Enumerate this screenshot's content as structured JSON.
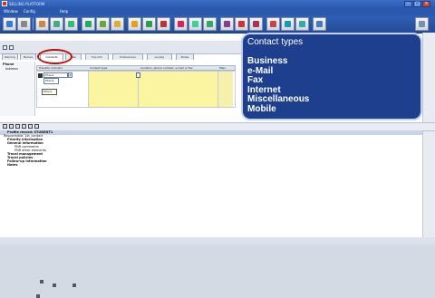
{
  "window": {
    "title": "SELLING PLATFORM"
  },
  "menu": [
    {
      "label": "Window"
    },
    {
      "label": "Config"
    },
    {
      "label": "Help"
    }
  ],
  "toolbar_icons": [
    "user-icon",
    "print-icon",
    "cut-icon",
    "network-icon",
    "globe-icon",
    "printer-icon",
    "tools-icon",
    "book-icon",
    "folder-icon",
    "arrow-icon",
    "plane-icon",
    "calendar-icon",
    "mail-icon",
    "chart-icon",
    "phone-icon",
    "car-icon",
    "hotel-icon",
    "ticket-icon",
    "search-icon",
    "settings-icon",
    "exit-icon"
  ],
  "tabs": [
    {
      "label": "Naming",
      "active": false
    },
    {
      "label": "Names",
      "active": false
    },
    {
      "label": "Contacts",
      "active": true
    },
    {
      "label": "Mail",
      "active": false
    },
    {
      "label": "Fop Info",
      "active": false
    },
    {
      "label": "Preferences",
      "active": false
    },
    {
      "label": "Loyalty",
      "active": false
    },
    {
      "label": "Notes",
      "active": false
    }
  ],
  "left_panel": {
    "heading": "Phone",
    "item": "Address"
  },
  "grid": {
    "columns": [
      "Transfer indicator",
      "Contact type",
      "Location, phone number, e-mail or fax",
      "Main"
    ],
    "row": {
      "transfer_indicator": "Phone"
    },
    "dropdown_value": "Phone",
    "tooltip": "Phone"
  },
  "tree": [
    {
      "label": "Profile record: STUDENT1",
      "bold": true,
      "highlight": true,
      "indent": 8
    },
    {
      "label": "Responsible: 1st_contact",
      "bold": false,
      "highlight": false,
      "indent": 4
    },
    {
      "label": "Priority information",
      "bold": true,
      "highlight": false,
      "indent": 8
    },
    {
      "label": "General information",
      "bold": true,
      "highlight": false,
      "indent": 8
    },
    {
      "label": "PNR comments",
      "bold": false,
      "highlight": false,
      "indent": 16
    },
    {
      "label": "PNR other elements",
      "bold": false,
      "highlight": false,
      "indent": 16
    },
    {
      "label": "Travel management",
      "bold": true,
      "highlight": false,
      "indent": 8
    },
    {
      "label": "Travel policies",
      "bold": true,
      "highlight": false,
      "indent": 8
    },
    {
      "label": "Follow-up information",
      "bold": true,
      "highlight": false,
      "indent": 8
    },
    {
      "label": "Notes",
      "bold": true,
      "highlight": false,
      "indent": 8
    }
  ],
  "callout": {
    "heading": "Contact types",
    "items": [
      "Business",
      "e-Mail",
      "Fax",
      "Internet",
      "Miscellaneous",
      "Mobile"
    ]
  },
  "colors": {
    "accent_blue": "#2a58ad",
    "callout_bg": "#1e3f8e",
    "highlight_yellow": "#fbf4a0",
    "circle_red": "#c01010"
  }
}
